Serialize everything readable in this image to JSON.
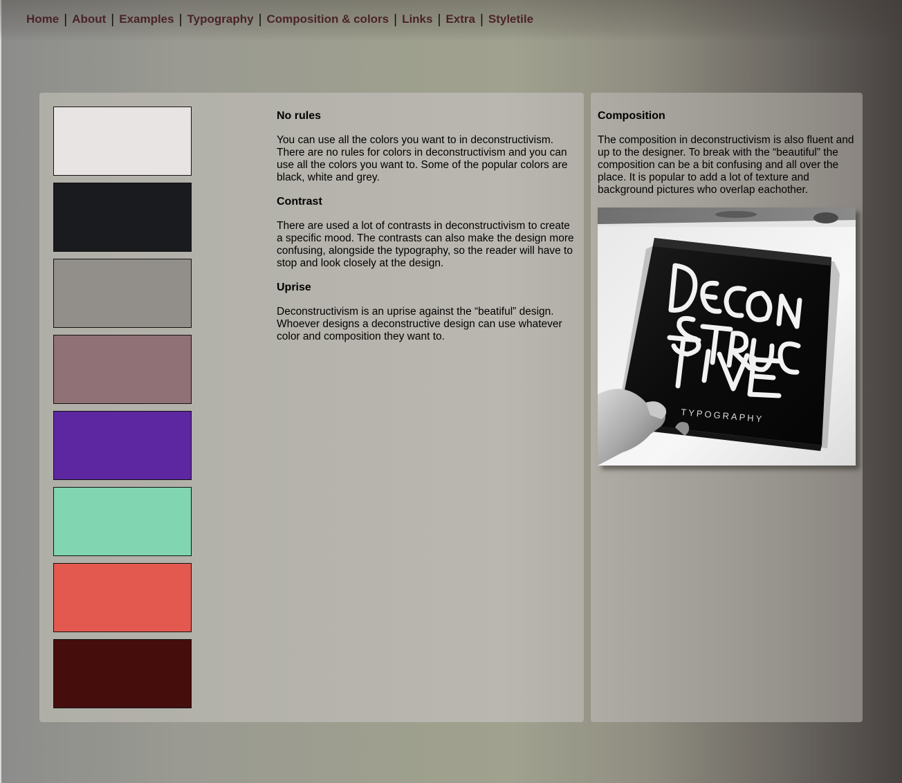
{
  "nav": {
    "items": [
      {
        "label": "Home"
      },
      {
        "label": "About"
      },
      {
        "label": "Examples"
      },
      {
        "label": "Typography"
      },
      {
        "label": "Composition & colors"
      },
      {
        "label": "Links"
      },
      {
        "label": "Extra"
      },
      {
        "label": "Styletile"
      }
    ],
    "link_color": "#4a2328"
  },
  "swatches": [
    {
      "color": "#e8e4e3"
    },
    {
      "color": "#1a1b1f"
    },
    {
      "color": "#928e8a"
    },
    {
      "color": "#907176"
    },
    {
      "color": "#5c27a0"
    },
    {
      "color": "#81d5b0"
    },
    {
      "color": "#e35950"
    },
    {
      "color": "#460d0d"
    }
  ],
  "main": {
    "sections": [
      {
        "heading": "No rules",
        "body": "You can use all the colors you want to in deconstructivism. There are no rules for colors in deconstructivism and you can use all the colors you want to. Some of the popular colors are black, white and grey."
      },
      {
        "heading": "Contrast",
        "body": "There are used a lot of contrasts in deconstructivism to create a specific mood. The contrasts can also make the design more confusing, alongside the typography, so the reader will have to stop and look closely at the design."
      },
      {
        "heading": "Uprise",
        "body": "Deconstructivism is an uprise against the “beatiful” design. Whoever designs a deconstructive design can use whatever color and composition they want to."
      }
    ]
  },
  "side": {
    "heading": "Composition",
    "body": "The composition in deconstructivism is also fluent and up to the designer. To break with the “beautiful” the composition can be a bit confusing and all over the place. It is popular to add a lot of texture and background pictures who overlap eachother.",
    "image": {
      "book_title_lines": [
        "DECON",
        "STRUC",
        "TIVE"
      ],
      "book_subtitle": "TYPOGRAPHY"
    }
  }
}
